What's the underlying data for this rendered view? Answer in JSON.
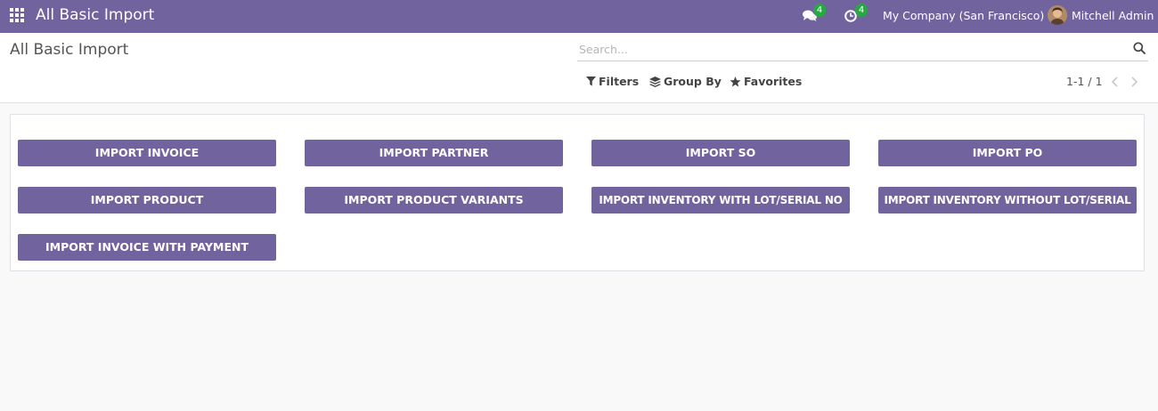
{
  "navbar": {
    "app_title": "All Basic Import",
    "messages_count": "4",
    "activities_count": "4",
    "company": "My Company (San Francisco)",
    "user_name": "Mitchell Admin"
  },
  "control_panel": {
    "breadcrumb": "All Basic Import",
    "search_placeholder": "Search...",
    "filters_label": "Filters",
    "group_by_label": "Group By",
    "favorites_label": "Favorites",
    "pager_value": "1-1 / 1"
  },
  "import_buttons": [
    "IMPORT INVOICE",
    "IMPORT PARTNER",
    "IMPORT SO",
    "IMPORT PO",
    "IMPORT PRODUCT",
    "IMPORT PRODUCT VARIANTS",
    "IMPORT INVENTORY WITH LOT/SERIAL NO",
    "IMPORT INVENTORY WITHOUT LOT/SERIAL",
    "IMPORT INVOICE WITH PAYMENT"
  ],
  "colors": {
    "brand": "#71639e",
    "badge": "#28a745",
    "background": "#f9f9fa"
  }
}
